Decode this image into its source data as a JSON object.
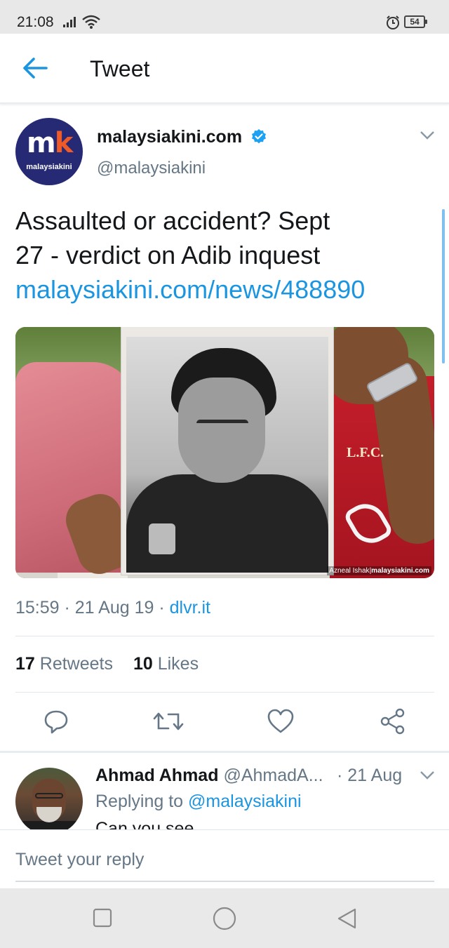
{
  "status_bar": {
    "time": "21:08",
    "battery": "54"
  },
  "header": {
    "title": "Tweet"
  },
  "tweet": {
    "author_name": "malaysiakini.com",
    "author_handle": "@malaysiakini",
    "avatar_logo_m": "m",
    "avatar_logo_k": "k",
    "avatar_logo_sub": "malaysiakini",
    "text_line1": "Assaulted or accident? Sept",
    "text_line2": "27 - verdict on Adib inquest",
    "link": "malaysiakini.com/news/488890",
    "photo_credit_name": "Azneal Ishak",
    "photo_credit_site": "malaysiakini.com",
    "photo_shirt_text": "L.F.C.",
    "time": "15:59",
    "date": "21 Aug 19",
    "source": "dlvr.it",
    "retweets_count": "17",
    "retweets_label": "Retweets",
    "likes_count": "10",
    "likes_label": "Likes"
  },
  "reply": {
    "name": "Ahmad Ahmad",
    "handle": "@AhmadA...",
    "time": "· 21 Aug",
    "replying_to_label": "Replying to",
    "replying_to_handle": "@malaysiakini",
    "text": "Can you see"
  },
  "composer": {
    "placeholder": "Tweet your reply"
  },
  "colors": {
    "link_blue": "#1b95e0",
    "secondary_text": "#657786",
    "mk_navy": "#262a74",
    "mk_orange": "#ee5a28"
  },
  "icons": {
    "back": "arrow-left-icon",
    "verified": "verified-badge-icon",
    "caret": "chevron-down-icon",
    "reply": "reply-icon",
    "retweet": "retweet-icon",
    "like": "heart-icon",
    "share": "share-icon",
    "nav_recents": "square-icon",
    "nav_home": "circle-icon",
    "nav_back": "triangle-back-icon"
  }
}
